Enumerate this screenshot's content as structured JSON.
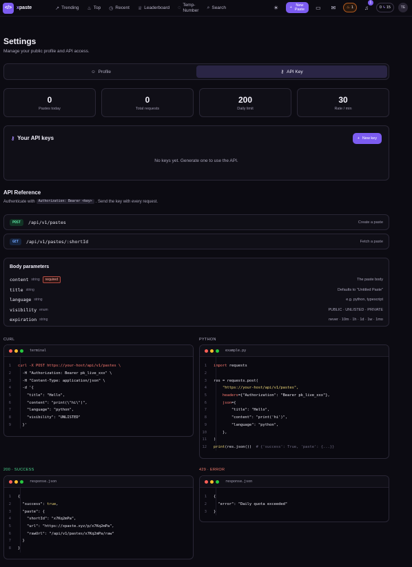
{
  "nav": {
    "logo_icon": "code-icon",
    "brand_prefix": "x",
    "brand_suffix": "paste",
    "links": [
      {
        "label": "Trending",
        "icon": "trending-icon"
      },
      {
        "label": "Top",
        "icon": "flame-icon"
      },
      {
        "label": "Recent",
        "icon": "clock-icon"
      },
      {
        "label": "Leaderboard",
        "icon": "trophy-icon"
      },
      {
        "label": "Temp-",
        "label2": "Number",
        "icon": "phone-icon"
      },
      {
        "label": "Search",
        "icon": "search-icon"
      }
    ],
    "new_paste_line1": "New",
    "new_paste_line2": "Paste",
    "streak_count": "1",
    "notifications_count": "1",
    "credits_left": "0",
    "credits_right": "15",
    "avatar_initials": "TE"
  },
  "page": {
    "title": "Settings",
    "subtitle": "Manage your public profile and API access."
  },
  "tabs": [
    {
      "label": "Profile",
      "active": false
    },
    {
      "label": "API Key",
      "active": true
    }
  ],
  "stats": [
    {
      "value": "0",
      "label": "Pastes today"
    },
    {
      "value": "0",
      "label": "Total requests"
    },
    {
      "value": "200",
      "label": "Daily limit"
    },
    {
      "value": "30",
      "label": "Rate / min"
    }
  ],
  "keys": {
    "title": "Your API keys",
    "new_key_label": "New key",
    "empty_text": "No keys yet. Generate one to use the API."
  },
  "api_ref": {
    "title": "API Reference",
    "auth_prefix": "Authenticate with",
    "auth_header": "Authorization: Bearer <key>",
    "auth_suffix": ". Send the key with every request.",
    "endpoints": [
      {
        "method": "POST",
        "path": "/api/v1/pastes",
        "desc": "Create a paste"
      },
      {
        "method": "GET",
        "path": "/api/v1/pastes/:shortId",
        "desc": "Fetch a paste"
      }
    ]
  },
  "params": {
    "title": "Body parameters",
    "required_label": "required",
    "rows": [
      {
        "name": "content",
        "type": "string",
        "required": true,
        "desc": "The paste body"
      },
      {
        "name": "title",
        "type": "string",
        "required": false,
        "desc": "Defaults to \"Untitled Paste\""
      },
      {
        "name": "language",
        "type": "string",
        "required": false,
        "desc": "e.g. python, typescript"
      },
      {
        "name": "visibility",
        "type": "enum",
        "required": false,
        "desc": "PUBLIC · UNLISTED · PRIVATE"
      },
      {
        "name": "expiration",
        "type": "string",
        "required": false,
        "desc": "never · 10m · 1h · 1d · 1w · 1mo"
      }
    ]
  },
  "code_blocks": {
    "curl": {
      "label": "CURL",
      "filename": "terminal",
      "lines": [
        [
          {
            "t": "curl -X POST https://your-host/api/v1/pastes \\",
            "c": "kw"
          }
        ],
        [
          {
            "t": "  -H \"Authorization: Bearer pk_live_xxx\" \\",
            "c": "tx"
          }
        ],
        [
          {
            "t": "  -H \"Content-Type: application/json\" \\",
            "c": "tx"
          }
        ],
        [
          {
            "t": "  -d '{",
            "c": "tx"
          }
        ],
        [
          {
            "t": "    \"title\": \"Hello\",",
            "c": "tx"
          }
        ],
        [
          {
            "t": "    \"content\": \"print(\\\"hi\\\")\",",
            "c": "tx"
          }
        ],
        [
          {
            "t": "    \"language\": \"python\",",
            "c": "tx"
          }
        ],
        [
          {
            "t": "    \"visibility\": \"UNLISTED\"",
            "c": "tx"
          }
        ],
        [
          {
            "t": "  }'",
            "c": "tx"
          }
        ]
      ]
    },
    "python": {
      "label": "PYTHON",
      "filename": "example.py",
      "lines": [
        [
          {
            "t": "import",
            "c": "kw"
          },
          {
            "t": " requests",
            "c": "tx"
          }
        ],
        [
          {
            "t": "",
            "c": "tx"
          }
        ],
        [
          {
            "t": "res = requests.post(",
            "c": "tx"
          }
        ],
        [
          {
            "t": "    \"https://your-host/api/v1/pastes\",",
            "c": "st"
          }
        ],
        [
          {
            "t": "    headers",
            "c": "kw"
          },
          {
            "t": "={\"Authorization\": \"Bearer pk_live_xxx\"},",
            "c": "tx"
          }
        ],
        [
          {
            "t": "    json",
            "c": "kw"
          },
          {
            "t": "={",
            "c": "tx"
          }
        ],
        [
          {
            "t": "        \"title\": \"Hello\",",
            "c": "tx"
          }
        ],
        [
          {
            "t": "        \"content\": \"print('hi')\",",
            "c": "tx"
          }
        ],
        [
          {
            "t": "        \"language\": \"python\",",
            "c": "tx"
          }
        ],
        [
          {
            "t": "    },",
            "c": "tx"
          }
        ],
        [
          {
            "t": ")",
            "c": "tx"
          }
        ],
        [
          {
            "t": "print",
            "c": "st"
          },
          {
            "t": "(res.json())  ",
            "c": "tx"
          },
          {
            "t": "# {'success': True, 'paste': {...}}",
            "c": "cm"
          }
        ]
      ]
    },
    "success": {
      "label": "200 · SUCCESS",
      "filename": "response.json",
      "lines": [
        [
          {
            "t": "{",
            "c": "tx"
          }
        ],
        [
          {
            "t": "  \"success\": ",
            "c": "tx"
          },
          {
            "t": "true",
            "c": "st"
          },
          {
            "t": ",",
            "c": "tx"
          }
        ],
        [
          {
            "t": "  \"paste\": {",
            "c": "tx"
          }
        ],
        [
          {
            "t": "    \"shortId\": \"x7Kq2mPa\",",
            "c": "tx"
          }
        ],
        [
          {
            "t": "    \"url\": \"https://xpaste.xyz/p/x7Kq2mPa\",",
            "c": "tx"
          }
        ],
        [
          {
            "t": "    \"rawUrl\": \"/api/v1/pastes/x7Kq2mPa/raw\"",
            "c": "tx"
          }
        ],
        [
          {
            "t": "  }",
            "c": "tx"
          }
        ],
        [
          {
            "t": "}",
            "c": "tx"
          }
        ]
      ]
    },
    "error": {
      "label": "429 · ERROR",
      "filename": "response.json",
      "lines": [
        [
          {
            "t": "{",
            "c": "tx"
          }
        ],
        [
          {
            "t": "  \"error\": \"Daily quota exceeded\"",
            "c": "tx"
          }
        ],
        [
          {
            "t": "}",
            "c": "tx"
          }
        ]
      ]
    }
  }
}
